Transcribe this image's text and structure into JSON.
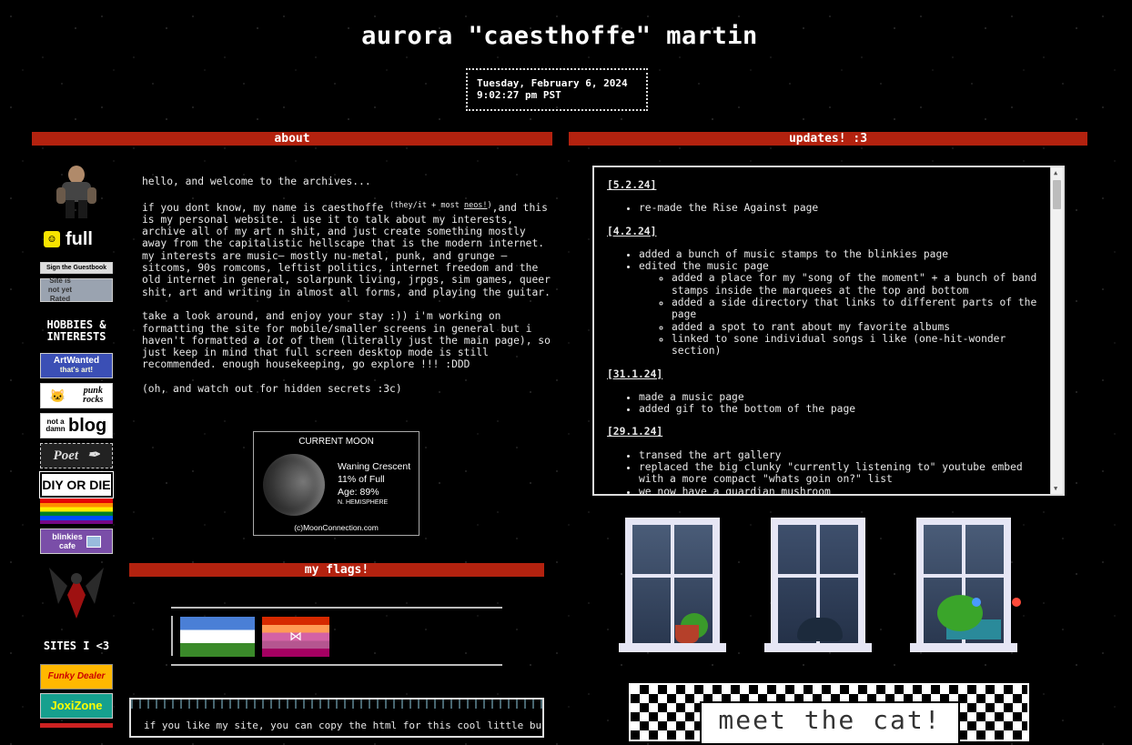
{
  "header": {
    "title": "aurora \"caesthoffe\" martin",
    "date": "Tuesday, February 6, 2024",
    "time": "9:02:27 pm PST"
  },
  "banners": {
    "about": "about",
    "updates": "updates! :3",
    "flags": "my flags!"
  },
  "sidebar": {
    "status_label": "full",
    "guestbook_label": "Sign the Guestbook",
    "rating_label": "Site is not yet Rated",
    "hobbies_heading": "HOBBIES & INTERESTS",
    "stamps": [
      {
        "l1": "ArtWanted",
        "l2": "that's art!"
      },
      {
        "l1": "punk",
        "l2": "rocks"
      },
      {
        "l1": "not a damn",
        "l2": "blog"
      },
      {
        "l1": "Poet",
        "l2": ""
      },
      {
        "l1": "DIY OR DIE",
        "l2": ""
      },
      {
        "l1": "blinkies",
        "l2": "cafe"
      }
    ],
    "sites_heading": "SITES I <3",
    "sites": [
      "Funky Dealer",
      "JoxiZone"
    ]
  },
  "about": {
    "p1": "hello, and welcome to the archives...",
    "p2_before": "if you dont know, my name is caesthoffe ",
    "p2_pronouns": "(they/it + most ",
    "p2_link": "neos!",
    "p2_close": ")",
    "p2_after": ",and this is my personal website. i use it to talk about my interests, archive all of my art n shit, and just create something mostly away from the capitalistic hellscape that is the modern internet. my interests are music— mostly nu-metal, punk, and grunge — sitcoms, 90s romcoms, leftist politics, internet freedom and the old internet in general, solarpunk living, jrpgs, sim games, queer shit, art and writing in almost all forms, and playing the guitar.",
    "p3_before": "take a look around, and enjoy your stay :)) i'm working on formatting the site for mobile/smaller screens in general but i haven't formatted ",
    "p3_em": "a lot",
    "p3_after": " of them (literally just the main page), so just keep in mind that full screen desktop mode is still recommended. enough housekeeping, go explore !!! :DDD",
    "p4": "(oh, and watch out for hidden secrets :3c)"
  },
  "moon": {
    "title": "CURRENT MOON",
    "phase": "Waning Crescent",
    "percent": "11% of Full",
    "age": "Age: 89%",
    "hemisphere": "N. HEMISPHERE",
    "credit": "(c)MoonConnection.com"
  },
  "code_box": {
    "text": "if you like my site, you can copy the html for this cool little button"
  },
  "updates": [
    {
      "date": "[5.2.24]",
      "items": [
        {
          "text": "re-made the Rise Against page"
        }
      ]
    },
    {
      "date": "[4.2.24]",
      "items": [
        {
          "text": "added a bunch of music stamps to the blinkies page"
        },
        {
          "text": "edited the music page",
          "sub": [
            "added a place for my \"song of the moment\" + a bunch of band stamps inside the marquees at the top and bottom",
            "added a side directory that links to different parts of the page",
            "added a spot to rant about my favorite albums",
            "linked to sone individual songs i like (one-hit-wonder section)"
          ]
        }
      ]
    },
    {
      "date": "[31.1.24]",
      "items": [
        {
          "text": "made a music page"
        },
        {
          "text": "added gif to the bottom of the page"
        }
      ]
    },
    {
      "date": "[29.1.24]",
      "items": [
        {
          "text": "transed the art gallery"
        },
        {
          "text": "replaced the big clunky \"currently listening to\" youtube embed with a more compact \"whats goin on?\" list"
        },
        {
          "text": "we now have a guardian mushroom"
        }
      ]
    }
  ],
  "meet_cat": "meet the cat!",
  "colors": {
    "banner": "#b3220f",
    "background": "#000000",
    "text": "#e8e8e8"
  }
}
